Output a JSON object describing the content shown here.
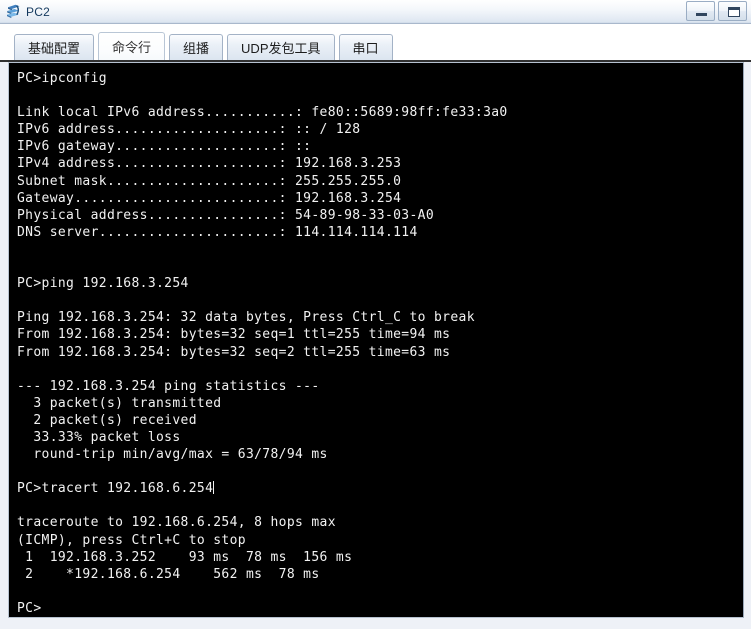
{
  "window": {
    "title": "PC2",
    "icon": "network-device-icon",
    "minimize_label": "minimize",
    "maximize_label": "maximize",
    "accent_color": "#14395e",
    "titlebar_color": "#dde6f1"
  },
  "tabs": [
    {
      "label": "基础配置",
      "active": false
    },
    {
      "label": "命令行",
      "active": true
    },
    {
      "label": "组播",
      "active": false
    },
    {
      "label": "UDP发包工具",
      "active": false
    },
    {
      "label": "串口",
      "active": false
    }
  ],
  "terminal": {
    "background_color": "#000000",
    "text_color": "#f2f2f2",
    "prompt": "PC>",
    "lines": [
      "PC>ipconfig",
      "",
      "Link local IPv6 address...........: fe80::5689:98ff:fe33:3a0",
      "IPv6 address....................: :: / 128",
      "IPv6 gateway....................: ::",
      "IPv4 address....................: 192.168.3.253",
      "Subnet mask.....................: 255.255.255.0",
      "Gateway.........................: 192.168.3.254",
      "Physical address................: 54-89-98-33-03-A0",
      "DNS server......................: 114.114.114.114",
      "",
      "",
      "PC>ping 192.168.3.254",
      "",
      "Ping 192.168.3.254: 32 data bytes, Press Ctrl_C to break",
      "From 192.168.3.254: bytes=32 seq=1 ttl=255 time=94 ms",
      "From 192.168.3.254: bytes=32 seq=2 ttl=255 time=63 ms",
      "",
      "--- 192.168.3.254 ping statistics ---",
      "  3 packet(s) transmitted",
      "  2 packet(s) received",
      "  33.33% packet loss",
      "  round-trip min/avg/max = 63/78/94 ms",
      "",
      "PC>tracert 192.168.6.254",
      "",
      "traceroute to 192.168.6.254, 8 hops max",
      "(ICMP), press Ctrl+C to stop",
      " 1  192.168.3.252    93 ms  78 ms  156 ms",
      " 2    *192.168.6.254    562 ms  78 ms",
      "",
      "PC>"
    ],
    "caret_after_line_index": 24,
    "commands": [
      "ipconfig",
      "ping 192.168.3.254",
      "tracert 192.168.6.254"
    ],
    "ipconfig_result": {
      "link_local_ipv6_address": "fe80::5689:98ff:fe33:3a0",
      "ipv6_address": ":: / 128",
      "ipv6_gateway": "::",
      "ipv4_address": "192.168.3.253",
      "subnet_mask": "255.255.255.0",
      "gateway": "192.168.3.254",
      "physical_address": "54-89-98-33-03-A0",
      "dns_server": "114.114.114.114"
    },
    "ping_result": {
      "target": "192.168.3.254",
      "data_bytes": "32",
      "break_hint": "Press Ctrl_C to break",
      "replies": [
        {
          "from": "192.168.3.254",
          "bytes": "32",
          "seq": "1",
          "ttl": "255",
          "time": "94 ms"
        },
        {
          "from": "192.168.3.254",
          "bytes": "32",
          "seq": "2",
          "ttl": "255",
          "time": "63 ms"
        }
      ],
      "transmitted": "3",
      "received": "2",
      "packet_loss": "33.33%",
      "round_trip_min": "63",
      "round_trip_avg": "78",
      "round_trip_max": "94"
    },
    "tracert_result": {
      "target": "192.168.6.254",
      "hops_max": "8",
      "stop_hint": "(ICMP), press Ctrl+C to stop",
      "hops": [
        {
          "index": "1",
          "address": "192.168.3.252",
          "times": [
            "93 ms",
            "78 ms",
            "156 ms"
          ]
        },
        {
          "index": "2",
          "address": "*192.168.6.254",
          "times": [
            "562 ms",
            "78 ms"
          ]
        }
      ]
    }
  }
}
